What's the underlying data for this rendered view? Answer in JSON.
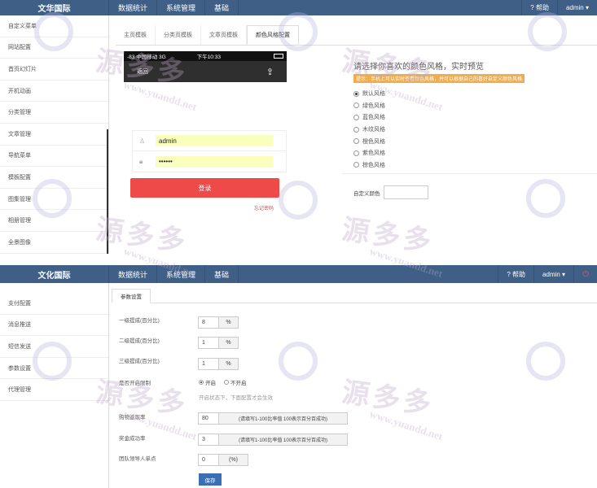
{
  "top": {
    "brand": "文华国际",
    "nav": [
      "数据统计",
      "系统管理",
      "基础"
    ],
    "help": "帮助",
    "user": "admin ▾",
    "sidebar": [
      "自定义菜单",
      "网站配置",
      "首页幻灯片",
      "开机动画",
      "分类管理",
      "文章管理",
      "导航菜单",
      "模板配置",
      "图集管理",
      "相册管理",
      "全景图像"
    ],
    "tabs": [
      "主页模板",
      "分类页模板",
      "文章页模板",
      "颜色风格配置"
    ],
    "phone": {
      "status_left": "-83 中国移动  3G",
      "status_time": "下午10:33",
      "back": "返回",
      "username": "admin",
      "password": "••••••",
      "login": "登录",
      "forgot": "忘记密码"
    },
    "scheme": {
      "title": "请选择你喜欢的颜色风格，实时预览",
      "tip": "提示：手机上可以实时查看颜色风格，并可以根据自己的喜好自定义颜色风格",
      "options": [
        "默认风格",
        "绿色风格",
        "蓝色风格",
        "木纹风格",
        "橙色风格",
        "紫色风格",
        "棕色风格"
      ],
      "selected_index": 0,
      "custom_label": "自定义颜色"
    }
  },
  "bottom": {
    "brand": "文化国际",
    "nav": [
      "数据统计",
      "系统管理",
      "基础"
    ],
    "help": "帮助",
    "user": "admin ▾",
    "sidebar": [
      "支付配置",
      "消息推送",
      "短信发送",
      "参数设置",
      "代理管理"
    ],
    "tab": "参数设置",
    "fields": {
      "level1_label": "一级提成(百分比)",
      "level1_value": "8",
      "level2_label": "二级提成(百分比)",
      "level2_value": "1",
      "level3_label": "三级提成(百分比)",
      "level3_value": "1",
      "pct_unit": "%",
      "limit_label": "是否开启限制",
      "radio_on": "开启",
      "radio_off": "不开启",
      "hint": "开启状态下，下面配置才会生效",
      "buy_rate_label": "购物返现率",
      "buy_rate_value": "80",
      "buy_rate_unit": "(请填写1-100比率值 100表示百分百成功)",
      "sell_rate_label": "奖金成功率",
      "sell_rate_value": "3",
      "sell_rate_unit": "(请填写1-100比率值 100表示百分百成功)",
      "team_label": "团队领导人单点",
      "team_value": "0",
      "team_unit": "(%)",
      "save": "保存"
    }
  },
  "watermark": {
    "cn": "源多多",
    "url": "www.yuandd.net"
  }
}
